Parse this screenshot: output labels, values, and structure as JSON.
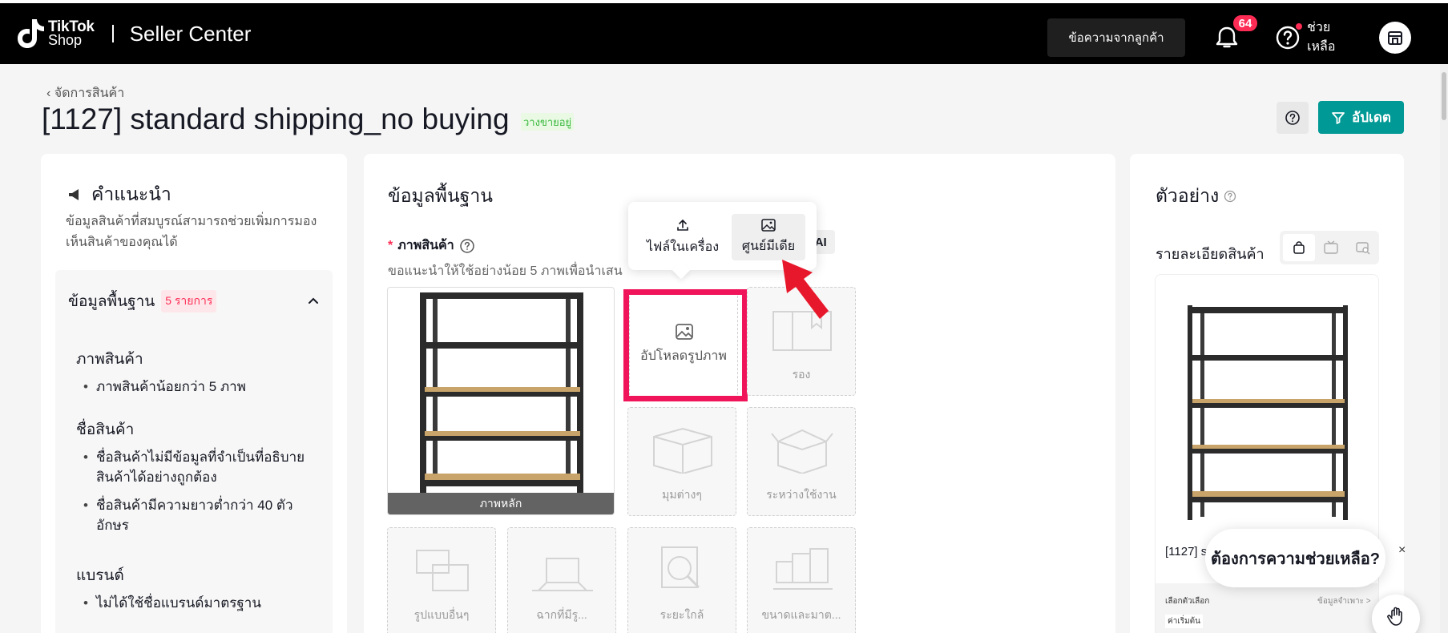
{
  "topbar": {
    "brand_line1": "TikTok",
    "brand_line2": "Shop",
    "title": "Seller Center",
    "messages_button": "ข้อความจากลูกค้า",
    "notification_count": "64",
    "help_label": "ช่วยเหลือ",
    "colors": {
      "background": "#000000",
      "badge": "#fe2c55"
    }
  },
  "header": {
    "breadcrumb": "จัดการสินค้า",
    "title": "[1127] standard shipping_no buying",
    "status": "วางขายอยู่",
    "update_button": "อัปเดต",
    "accent_color": "#009995"
  },
  "tips": {
    "title": "คำแนะนำ",
    "description": "ข้อมูลสินค้าที่สมบูรณ์สามารถช่วยเพิ่มการมองเห็นสินค้าของคุณได้",
    "section_title": "ข้อมูลพื้นฐาน",
    "section_count": "5 รายการ",
    "groups": [
      {
        "title": "ภาพสินค้า",
        "items": [
          "ภาพสินค้าน้อยกว่า 5 ภาพ"
        ]
      },
      {
        "title": "ชื่อสินค้า",
        "items": [
          "ชื่อสินค้าไม่มีข้อมูลที่จำเป็นที่อธิบายสินค้าได้อย่างถูกต้อง",
          "ชื่อสินค้ามีความยาวต่ำกว่า 40 ตัวอักษร"
        ]
      },
      {
        "title": "แบรนด์",
        "items": [
          "ไม่ได้ใช้ชื่อแบรนด์มาตรฐาน"
        ]
      }
    ]
  },
  "basic": {
    "title": "ข้อมูลพื้นฐาน",
    "images_label": "ภาพสินค้า",
    "required_mark": "*",
    "hint": "ขอแนะนำให้ใช้อย่างน้อย 5 ภาพเพื่อนำเสน",
    "ai_chip": "ดย AI",
    "main_caption": "ภาพหลัก",
    "upload_label": "อัปโหลดรูปภาพ",
    "slots": [
      "รอง",
      "มุมต่างๆ",
      "ระหว่างใช้งาน",
      "รูปแบบอื่นๆ",
      "ฉากที่มีรู...",
      "ระยะใกล้",
      "ขนาดและมาต..."
    ]
  },
  "popover": {
    "option_local": "ไฟล์ในเครื่อง",
    "option_media": "ศูนย์มีเดีย"
  },
  "preview": {
    "title": "ตัวอย่าง",
    "subtitle": "รายละเอียดสินค้า",
    "product_name": "[1127] s",
    "option_select": "เลือกตัวเลือก",
    "option_spec": "ข้อมูลจำเพาะ >",
    "start_price": "ค่าเริ่มต้น"
  },
  "help_widget": {
    "text": "ต้องการความช่วยเหลือ?",
    "close": "×"
  }
}
